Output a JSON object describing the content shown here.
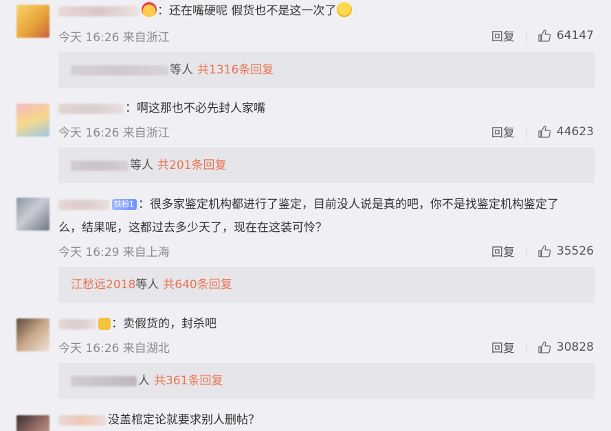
{
  "comments": [
    {
      "text": "：还在嘴硬呢 假货也不是这一次了",
      "time": "今天 16:26 来自浙江",
      "reply_label": "回复",
      "likes": "64147",
      "replies_suffix": "等人",
      "replies_count": "共1316条回复"
    },
    {
      "text": "：啊这那也不必先封人家嘴",
      "time": "今天 16:26 来自浙江",
      "reply_label": "回复",
      "likes": "44623",
      "replies_suffix": "等人",
      "replies_count": "共201条回复"
    },
    {
      "badge": "铁粉1",
      "text": "：很多家鉴定机构都进行了鉴定，目前没人说是真的吧，你不是找鉴定机构鉴定了",
      "text2": "么，结果呢，这都过去多少天了，现在在这装可怜？",
      "time": "今天 16:29 来自上海",
      "reply_label": "回复",
      "likes": "35526",
      "replies_user": "江愁远2018",
      "replies_suffix": " 等人",
      "replies_count": "共640条回复"
    },
    {
      "text": "：卖假货的，封杀吧",
      "time": "今天 16:26 来自湖北",
      "reply_label": "回复",
      "likes": "30828",
      "replies_suffix": "人",
      "replies_count": "共361条回复"
    },
    {
      "text": "没盖棺定论就要求别人删帖？"
    }
  ],
  "colors": {
    "link": "#eb7350",
    "background": "#f0f0f4",
    "reply_box": "#e6e6ea"
  }
}
